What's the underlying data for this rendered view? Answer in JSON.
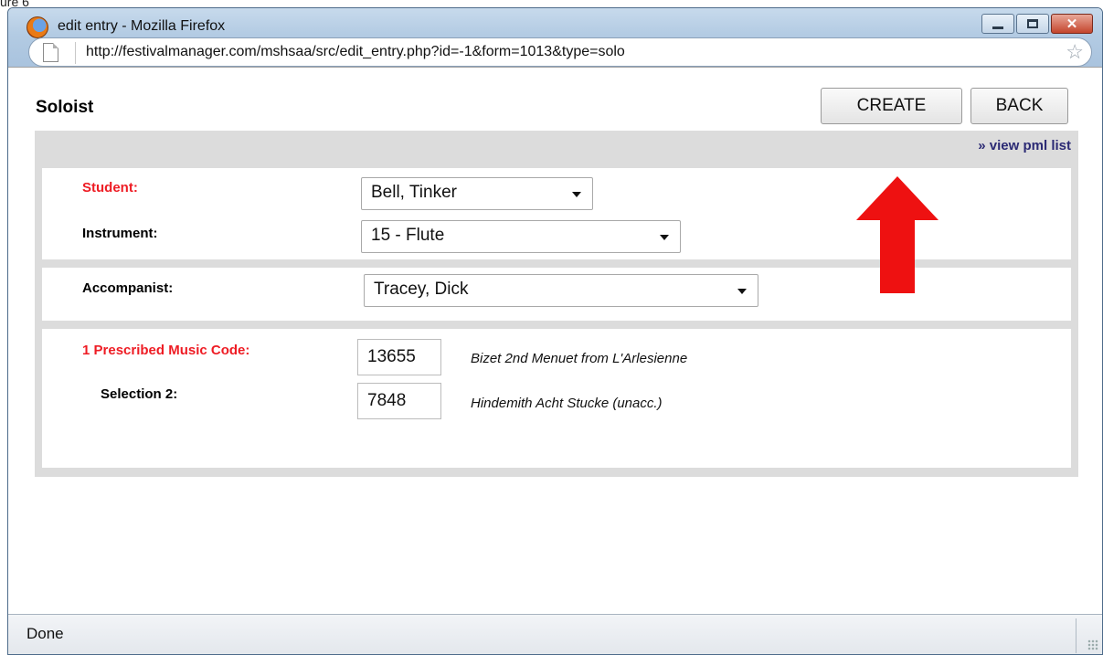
{
  "figure_label": "ure 6",
  "window": {
    "title": "edit entry - Mozilla Firefox",
    "url": "http://festivalmanager.com/mshsaa/src/edit_entry.php?id=-1&form=1013&type=solo"
  },
  "page": {
    "title": "Soloist",
    "create_label": "CREATE",
    "back_label": "BACK",
    "pml_link": "» view pml list"
  },
  "form": {
    "student_label": "Student:",
    "student_value": "Bell, Tinker",
    "instrument_label": "Instrument:",
    "instrument_value": "15 - Flute",
    "accompanist_label": "Accompanist:",
    "accompanist_value": "Tracey, Dick",
    "pmc_label": "1 Prescribed Music Code:",
    "pmc_value": "13655",
    "pmc_title": "Bizet 2nd Menuet from L'Arlesienne",
    "sel2_label": "Selection 2:",
    "sel2_value": "7848",
    "sel2_title": "Hindemith Acht Stucke (unacc.)"
  },
  "status": {
    "text": "Done"
  },
  "colors": {
    "required_label": "#ee1c24",
    "link": "#2b2a74",
    "annotation_arrow": "#ee1111"
  }
}
